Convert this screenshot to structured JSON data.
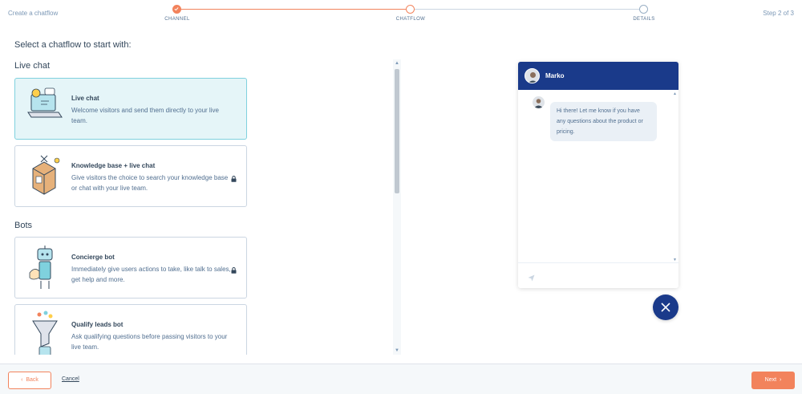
{
  "header": {
    "title": "Create a chatflow",
    "step_indicator": "Step 2 of 3",
    "steps": [
      {
        "label": "CHANNEL",
        "state": "complete"
      },
      {
        "label": "CHATFLOW",
        "state": "current"
      },
      {
        "label": "DETAILS",
        "state": "todo"
      }
    ]
  },
  "main": {
    "heading": "Select a chatflow to start with:",
    "sections": [
      {
        "title": "Live chat",
        "cards": [
          {
            "title": "Live chat",
            "description": "Welcome visitors and send them directly to your live team.",
            "selected": true,
            "locked": false,
            "icon": "laptop-chat-illustration"
          },
          {
            "title": "Knowledge base + live chat",
            "description": "Give visitors the choice to search your knowledge base or chat with your live team.",
            "selected": false,
            "locked": true,
            "icon": "knowledge-base-illustration"
          }
        ]
      },
      {
        "title": "Bots",
        "cards": [
          {
            "title": "Concierge bot",
            "description": "Immediately give users actions to take, like talk to sales, get help and more.",
            "selected": false,
            "locked": true,
            "icon": "concierge-bot-illustration"
          },
          {
            "title": "Qualify leads bot",
            "description": "Ask qualifying questions before passing visitors to your live team.",
            "selected": false,
            "locked": false,
            "icon": "funnel-bot-illustration"
          }
        ]
      }
    ]
  },
  "preview": {
    "agent_name": "Marko",
    "message": "Hi there! Let me know if you have any questions about the product or pricing."
  },
  "footer": {
    "back_label": "Back",
    "cancel_label": "Cancel",
    "next_label": "Next"
  },
  "colors": {
    "accent": "#f2835c",
    "widget_header": "#1a3a8a",
    "selected_card": "#e5f5f8"
  }
}
